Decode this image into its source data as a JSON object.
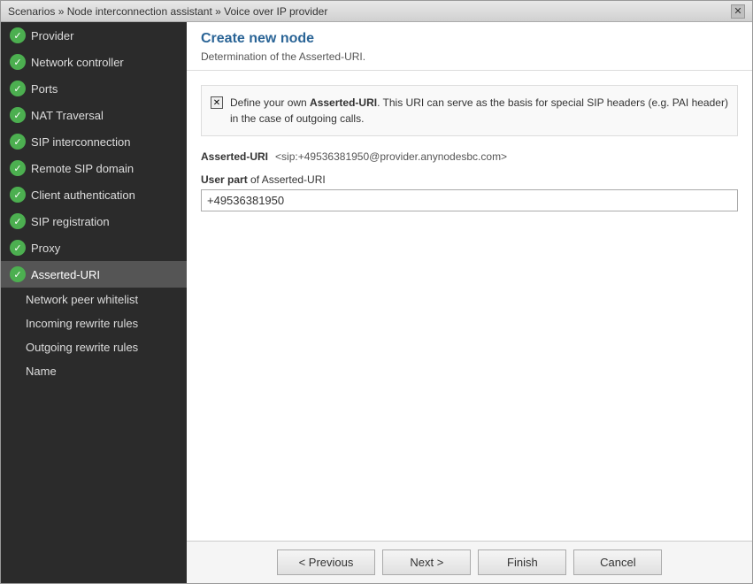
{
  "titleBar": {
    "text": "Scenarios » Node interconnection assistant » Voice over IP provider",
    "closeLabel": "✕"
  },
  "sidebar": {
    "items": [
      {
        "id": "provider",
        "label": "Provider",
        "hasCheck": true,
        "active": false
      },
      {
        "id": "network-controller",
        "label": "Network controller",
        "hasCheck": true,
        "active": false
      },
      {
        "id": "ports",
        "label": "Ports",
        "hasCheck": true,
        "active": false
      },
      {
        "id": "nat-traversal",
        "label": "NAT Traversal",
        "hasCheck": true,
        "active": false
      },
      {
        "id": "sip-interconnection",
        "label": "SIP interconnection",
        "hasCheck": true,
        "active": false
      },
      {
        "id": "remote-sip-domain",
        "label": "Remote SIP domain",
        "hasCheck": true,
        "active": false
      },
      {
        "id": "client-authentication",
        "label": "Client authentication",
        "hasCheck": true,
        "active": false
      },
      {
        "id": "sip-registration",
        "label": "SIP registration",
        "hasCheck": true,
        "active": false
      },
      {
        "id": "proxy",
        "label": "Proxy",
        "hasCheck": true,
        "active": false
      },
      {
        "id": "asserted-uri",
        "label": "Asserted-URI",
        "hasCheck": true,
        "active": true
      },
      {
        "id": "network-peer-whitelist",
        "label": "Network peer whitelist",
        "hasCheck": false,
        "active": false
      },
      {
        "id": "incoming-rewrite-rules",
        "label": "Incoming rewrite rules",
        "hasCheck": false,
        "active": false
      },
      {
        "id": "outgoing-rewrite-rules",
        "label": "Outgoing rewrite rules",
        "hasCheck": false,
        "active": false
      },
      {
        "id": "name",
        "label": "Name",
        "hasCheck": false,
        "active": false
      }
    ]
  },
  "panel": {
    "title": "Create new node",
    "subtitle": "Determination of the Asserted-URI."
  },
  "content": {
    "checkboxChecked": "✕",
    "infoTextPart1": "Define your own ",
    "infoTextBold": "Asserted-URI",
    "infoTextPart2": ". This URI can serve as the basis for special SIP headers (e.g. PAI header) in the case of outgoing calls.",
    "assertedUriLabel": "Asserted-URI",
    "assertedUriValue": "<sip:+49536381950@provider.anynodesbc.com>",
    "userPartLabel": "User part",
    "userPartOf": " of Asserted-URI",
    "userPartValue": "+49536381950"
  },
  "footer": {
    "previousLabel": "< Previous",
    "nextLabel": "Next >",
    "finishLabel": "Finish",
    "cancelLabel": "Cancel"
  }
}
